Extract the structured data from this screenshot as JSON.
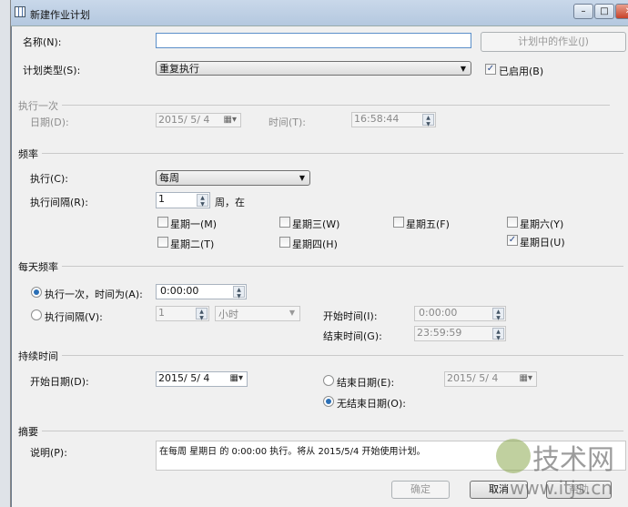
{
  "window": {
    "title": "新建作业计划",
    "minimize": "–",
    "maximize": "□",
    "close": "✕"
  },
  "name": {
    "label": "名称(N):",
    "value": "",
    "jobs_button": "计划中的作业(J)"
  },
  "schedule_type": {
    "label": "计划类型(S):",
    "value": "重复执行",
    "enabled_label": "已启用(B)",
    "enabled": true
  },
  "once": {
    "group": "执行一次",
    "date_label": "日期(D):",
    "date": "2015/ 5/ 4",
    "time_label": "时间(T):",
    "time": "16:58:44"
  },
  "frequency": {
    "group": "频率",
    "occurs_label": "执行(C):",
    "occurs": "每周",
    "interval_label": "执行间隔(R):",
    "interval": "1",
    "interval_suffix": "周，在",
    "days": [
      {
        "label": "星期一(M)",
        "checked": false
      },
      {
        "label": "星期二(T)",
        "checked": false
      },
      {
        "label": "星期三(W)",
        "checked": false
      },
      {
        "label": "星期四(H)",
        "checked": false
      },
      {
        "label": "星期五(F)",
        "checked": false
      },
      {
        "label": "星期六(Y)",
        "checked": false
      },
      {
        "label": "星期日(U)",
        "checked": true
      }
    ]
  },
  "daily": {
    "group": "每天频率",
    "once_label": "执行一次，时间为(A):",
    "once_time": "0:00:00",
    "every_label": "执行间隔(V):",
    "every_value": "1",
    "every_unit": "小时",
    "start_label": "开始时间(I):",
    "start": "0:00:00",
    "end_label": "结束时间(G):",
    "end": "23:59:59",
    "selected": "once"
  },
  "duration": {
    "group": "持续时间",
    "start_label": "开始日期(D):",
    "start": "2015/ 5/ 4",
    "end_label": "结束日期(E):",
    "end": "2015/ 5/ 4",
    "noend_label": "无结束日期(O):",
    "selected": "noend"
  },
  "summary": {
    "group": "摘要",
    "desc_label": "说明(P):",
    "desc": "在每周 星期日 的 0:00:00 执行。将从 2015/5/4 开始使用计划。"
  },
  "buttons": {
    "ok": "确定",
    "cancel": "取消",
    "help": "帮助"
  },
  "watermark": {
    "logo": "17技术网",
    "url": "www.itjs.cn"
  }
}
